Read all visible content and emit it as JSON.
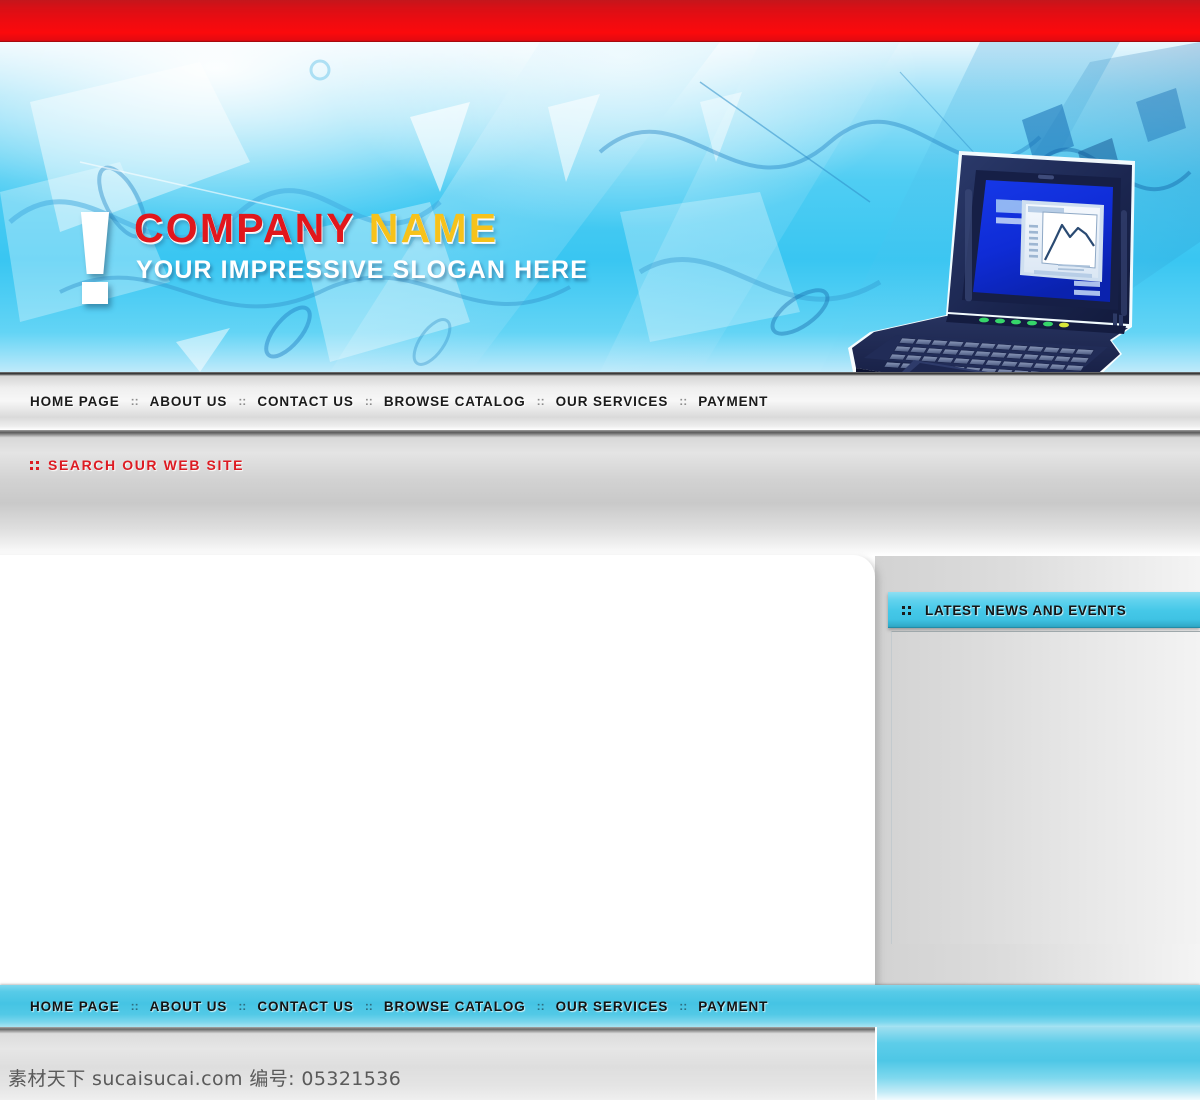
{
  "site": {
    "company_name_part1": "COMPANY",
    "company_name_part2": "NAME",
    "slogan": "YOUR IMPRESSIVE SLOGAN HERE"
  },
  "colors": {
    "top_bar_red": "#ef0b10",
    "company_red": "#e1171c",
    "company_yellow": "#f6c21b",
    "accent_cyan": "#45c4e4",
    "search_label_red": "#dd1b22",
    "banner_blue": "#39c6f2"
  },
  "main_nav": {
    "separator": "::",
    "items": [
      {
        "label": "HOME PAGE"
      },
      {
        "label": "ABOUT US"
      },
      {
        "label": "CONTACT US"
      },
      {
        "label": "BROWSE CATALOG"
      },
      {
        "label": "OUR SERVICES"
      },
      {
        "label": "PAYMENT"
      }
    ]
  },
  "search": {
    "title": "SEARCH OUR WEB SITE",
    "bullet": "::"
  },
  "news": {
    "title": "LATEST NEWS AND EVENTS",
    "bullet": "::",
    "body": ""
  },
  "footer_nav": {
    "separator": "::",
    "items": [
      {
        "label": "HOME PAGE"
      },
      {
        "label": "ABOUT US"
      },
      {
        "label": "CONTACT US"
      },
      {
        "label": "BROWSE CATALOG"
      },
      {
        "label": "OUR SERVICES"
      },
      {
        "label": "PAYMENT"
      }
    ]
  },
  "watermark": {
    "text": "素材天下 sucaisucai.com  编号: 05321536"
  }
}
